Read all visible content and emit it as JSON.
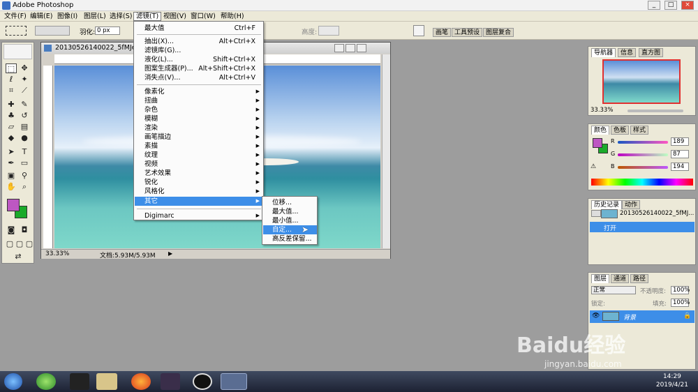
{
  "app": {
    "title": "Adobe Photoshop",
    "win_min": "_",
    "win_max": "□",
    "win_close": "×"
  },
  "menubar": [
    {
      "label": "文件(F)"
    },
    {
      "label": "编辑(E)"
    },
    {
      "label": "图像(I)"
    },
    {
      "label": "图层(L)"
    },
    {
      "label": "选择(S)"
    },
    {
      "label": "滤镜(T)"
    },
    {
      "label": "视图(V)"
    },
    {
      "label": "窗口(W)"
    },
    {
      "label": "帮助(H)"
    }
  ],
  "options": {
    "feather_label": "羽化:",
    "feather_value": "0 px",
    "height_label": "高度:",
    "tabs": [
      "画笔",
      "工具预设",
      "图层复合"
    ]
  },
  "document": {
    "title": "20130526140022_5fMJe.jpg",
    "zoom": "33.33%",
    "doc_info": "文档:5.93M/5.93M"
  },
  "filter_menu": {
    "top": [
      {
        "label": "最大值",
        "shortcut": "Ctrl+F"
      }
    ],
    "group2": [
      {
        "label": "抽出(X)...",
        "shortcut": "Alt+Ctrl+X"
      },
      {
        "label": "滤镜库(G)...",
        "shortcut": ""
      },
      {
        "label": "液化(L)...",
        "shortcut": "Shift+Ctrl+X"
      },
      {
        "label": "图案生成器(P)...",
        "shortcut": "Alt+Shift+Ctrl+X"
      },
      {
        "label": "消失点(V)...",
        "shortcut": "Alt+Ctrl+V"
      }
    ],
    "submenus": [
      "像素化",
      "扭曲",
      "杂色",
      "模糊",
      "渲染",
      "画笔描边",
      "素描",
      "纹理",
      "视频",
      "艺术效果",
      "锐化",
      "风格化",
      "其它"
    ],
    "bottom": [
      "Digimarc"
    ]
  },
  "other_submenu": [
    "位移...",
    "最大值...",
    "最小值...",
    "自定...",
    "高反差保留..."
  ],
  "navigator": {
    "tabs": [
      "导航器",
      "信息",
      "直方图"
    ],
    "zoom": "33.33%"
  },
  "color_panel": {
    "tabs": [
      "颜色",
      "色板",
      "样式"
    ],
    "R": "189",
    "G": "87",
    "B": "194",
    "foreground": "#bd57c2",
    "background": "#1aaa2a"
  },
  "history": {
    "tabs": [
      "历史记录",
      "动作"
    ],
    "snapshot": "20130526140022_5fMJ...",
    "step": "打开"
  },
  "layers": {
    "tabs": [
      "图层",
      "通道",
      "路径"
    ],
    "blend": "正常",
    "opacity_label": "不透明度:",
    "opacity": "100%",
    "lock_label": "锁定:",
    "fill_label": "填充:",
    "fill": "100%",
    "layer_name": "背景"
  },
  "taskbar": {
    "time": "14:29",
    "date": "2019/4/21"
  },
  "watermark": {
    "brand": "Baidu经验",
    "url": "jingyan.baidu.com"
  }
}
